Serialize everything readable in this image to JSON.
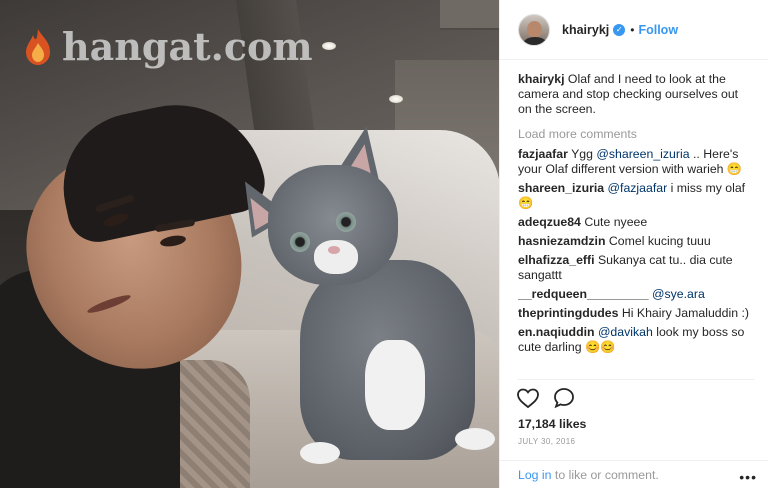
{
  "watermark": {
    "text": "hangat.com"
  },
  "post": {
    "username": "khairykj",
    "follow_label": "Follow",
    "dot": "•",
    "caption": {
      "username": "khairykj",
      "text": "Olaf and I need to look at the camera and stop checking ourselves out on the screen."
    },
    "load_more": "Load more comments",
    "comments": [
      {
        "user": "fazjaafar",
        "mention": "@shareen_izuria",
        "text_before": "Ygg ",
        "text_after": " .. Here's your Olaf different version with warieh",
        "emoji": "😁"
      },
      {
        "user": "shareen_izuria",
        "mention": "@fazjaafar",
        "text_before": "",
        "text_after": " i miss my olaf",
        "emoji": "😁"
      },
      {
        "user": "adeqzue84",
        "mention": "",
        "text_before": "Cute nyeee",
        "text_after": "",
        "emoji": ""
      },
      {
        "user": "hasniezamdzin",
        "mention": "",
        "text_before": "Comel kucing tuuu",
        "text_after": "",
        "emoji": ""
      },
      {
        "user": "elhafizza_effi",
        "mention": "",
        "text_before": "Sukanya cat tu.. dia cute sangattt",
        "text_after": "",
        "emoji": ""
      },
      {
        "user": "__redqueen_________",
        "mention": "@sye.ara",
        "text_before": "",
        "text_after": "",
        "emoji": ""
      },
      {
        "user": "theprintingdudes",
        "mention": "",
        "text_before": "Hi Khairy Jamaluddin :)",
        "text_after": "",
        "emoji": ""
      },
      {
        "user": "en.naqiuddin",
        "mention": "@davikah",
        "text_before": "",
        "text_after": " look my boss so cute darling",
        "emoji": "😊😊"
      }
    ],
    "likes": "17,184 likes",
    "date": "JULY 30, 2016",
    "footer": {
      "login_link": "Log in",
      "login_rest": " to like or comment.",
      "more": "•••"
    }
  },
  "icons": {
    "like": "heart-icon",
    "comment": "comment-icon",
    "verified": "verified-badge-icon"
  },
  "colors": {
    "link_blue": "#3897f0",
    "mention_blue": "#003569",
    "muted": "#999999",
    "text": "#262626"
  }
}
